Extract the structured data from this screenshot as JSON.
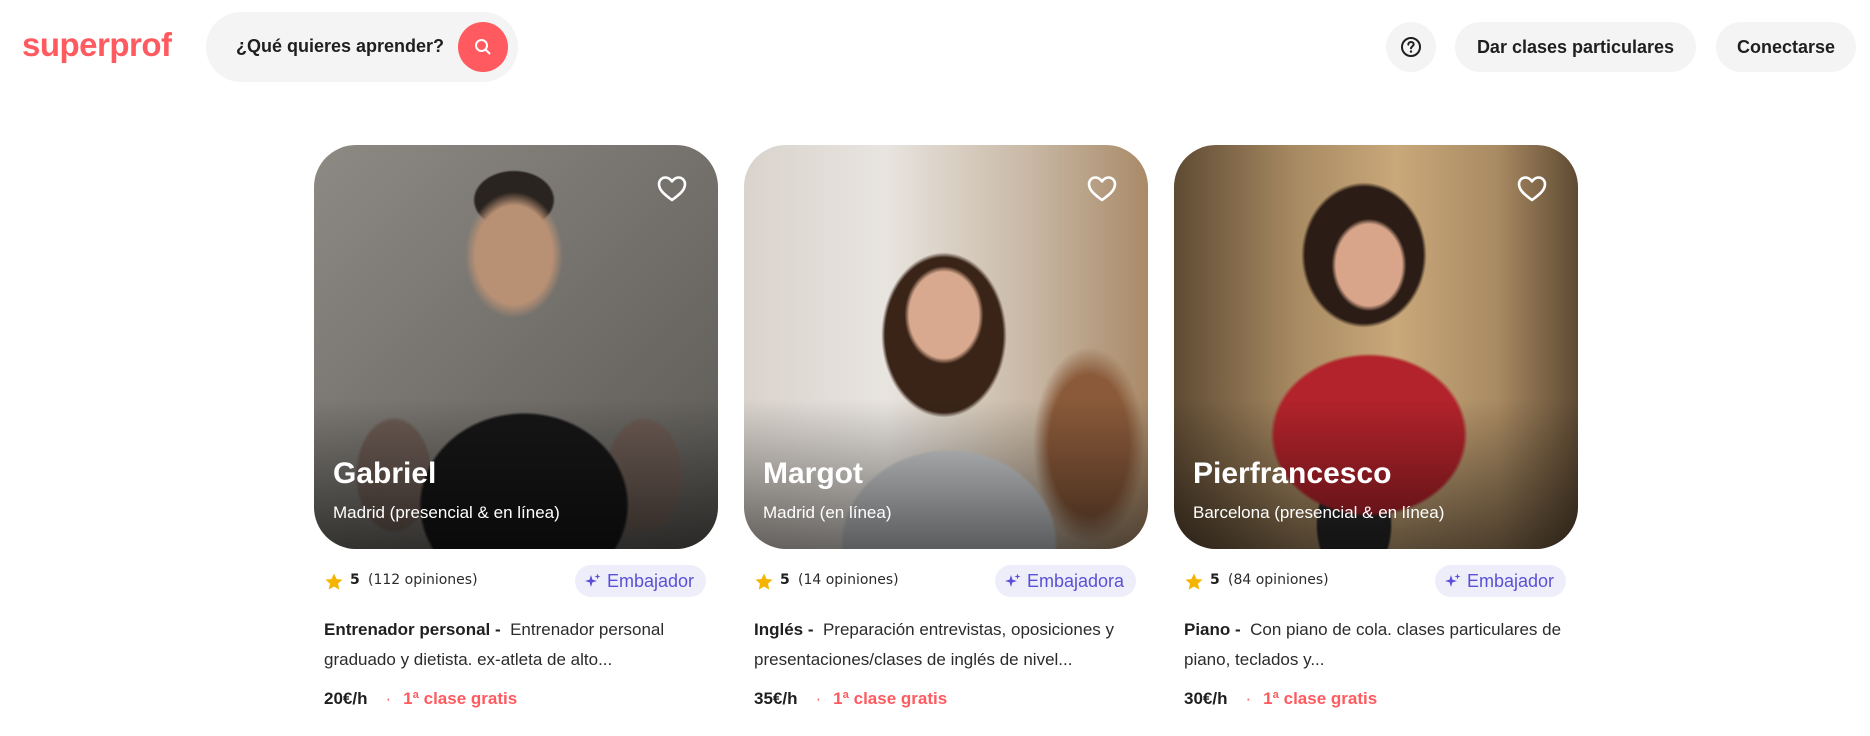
{
  "header": {
    "logo": "superprof",
    "search": {
      "placeholder": "¿Qué quieres aprender?",
      "icon": "search-icon"
    },
    "help_icon": "help-circle-icon",
    "teach_label": "Dar clases particulares",
    "login_label": "Conectarse"
  },
  "colors": {
    "brand": "#ff5a5f",
    "badge_text": "#5b4fd6",
    "badge_bg": "#eeeefb",
    "star": "#f5b400"
  },
  "tutors": [
    {
      "name": "Gabriel",
      "location": "Madrid (presencial & en línea)",
      "rating": "5",
      "reviews": "(112 opiniones)",
      "badge": "Embajador",
      "subject": "Entrenador personal -",
      "description": "Entrenador personal graduado y dietista. ex-atleta de alto...",
      "price": "20€/h",
      "bullet": "·",
      "free_class": "1ª clase gratis"
    },
    {
      "name": "Margot",
      "location": "Madrid (en línea)",
      "rating": "5",
      "reviews": "(14 opiniones)",
      "badge": "Embajadora",
      "subject": "Inglés -",
      "description": "Preparación entrevistas, oposiciones y presentaciones/clases de inglés de nivel...",
      "price": "35€/h",
      "bullet": "·",
      "free_class": "1ª clase gratis"
    },
    {
      "name": "Pierfrancesco",
      "location": "Barcelona (presencial & en línea)",
      "rating": "5",
      "reviews": "(84 opiniones)",
      "badge": "Embajador",
      "subject": "Piano -",
      "description": "Con piano de cola. clases particulares de piano, teclados y...",
      "price": "30€/h",
      "bullet": "·",
      "free_class": "1ª clase gratis"
    }
  ]
}
